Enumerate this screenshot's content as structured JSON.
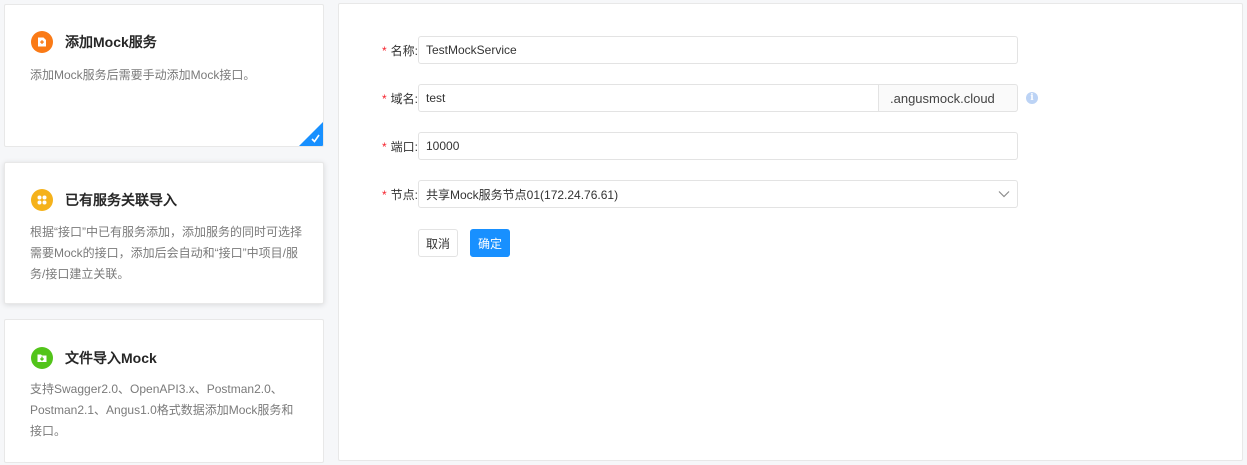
{
  "cards": [
    {
      "title": "添加Mock服务",
      "desc": "添加Mock服务后需要手动添加Mock接口。",
      "icon": "add-file-icon",
      "icon_color": "#fa7a16",
      "selected": true
    },
    {
      "title": "已有服务关联导入",
      "desc": "根据“接口”中已有服务添加，添加服务的同时可选择需要Mock的接口，添加后会自动和“接口”中项目/服务/接口建立关联。",
      "icon": "apps-grid-icon",
      "icon_color": "#f5b21b",
      "selected": false
    },
    {
      "title": "文件导入Mock",
      "desc": "支持Swagger2.0、OpenAPI3.x、Postman2.0、Postman2.1、Angus1.0格式数据添加Mock服务和接口。",
      "icon": "import-file-icon",
      "icon_color": "#52c41a",
      "selected": false
    }
  ],
  "form": {
    "name_label": "名称",
    "name_value": "TestMockService",
    "domain_label": "域名",
    "domain_value": "test",
    "domain_suffix": ".angusmock.cloud",
    "port_label": "端口",
    "port_value": "10000",
    "node_label": "节点",
    "node_value": "共享Mock服务节点01(172.24.76.61)",
    "colon": ":",
    "required_mark": "*",
    "cancel_label": "取消",
    "ok_label": "确定"
  },
  "colors": {
    "primary": "#1890ff",
    "required": "#f5222d"
  }
}
